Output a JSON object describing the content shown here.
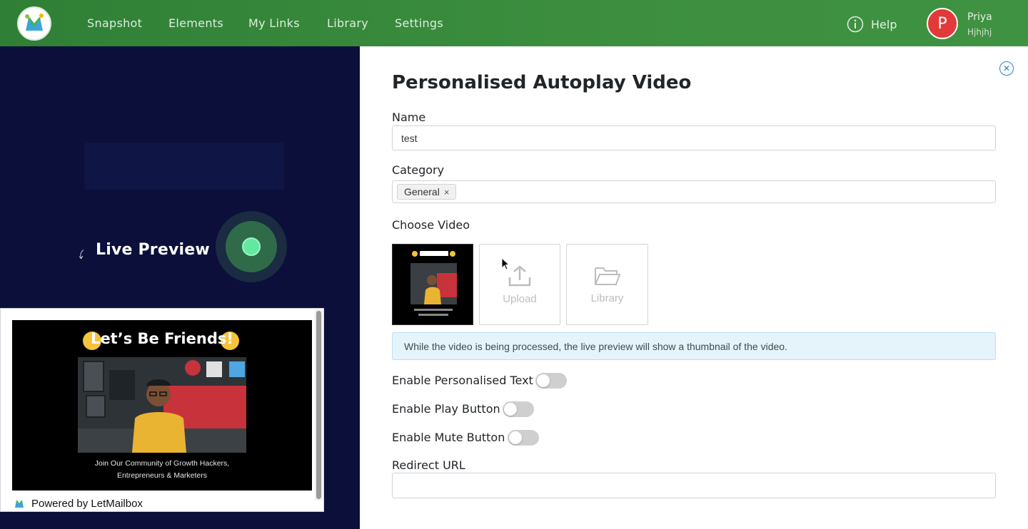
{
  "nav": {
    "items": [
      "Snapshot",
      "Elements",
      "My Links",
      "Library",
      "Settings"
    ],
    "help_label": "Help",
    "user": {
      "initial": "P",
      "name": "Priya",
      "subtitle": "Hjhjhj"
    }
  },
  "preview": {
    "live_label": "Live Preview",
    "video_title": "Let’s Be Friends!",
    "caption_line1": "Join Our Community of Growth Hackers,",
    "caption_line2": "Entrepreneurs & Marketers",
    "powered_by": "Powered by LetMailbox"
  },
  "form": {
    "title": "Personalised Autoplay Video",
    "name_label": "Name",
    "name_value": "test",
    "category_label": "Category",
    "category_tag": "General",
    "choose_video_label": "Choose Video",
    "upload_label": "Upload",
    "library_label": "Library",
    "info_text": "While the video is being processed, the live preview will show a thumbnail of the video.",
    "toggles": [
      {
        "label": "Enable Personalised Text",
        "enabled": false
      },
      {
        "label": "Enable Play Button",
        "enabled": false
      },
      {
        "label": "Enable Mute Button",
        "enabled": false
      }
    ],
    "redirect_label": "Redirect URL",
    "redirect_value": ""
  },
  "colors": {
    "nav_green": "#3d8f3f",
    "panel_dark": "#0b0f3a",
    "avatar_red": "#e23a3a",
    "info_bg": "#e5f4fb",
    "close_blue": "#2d7fc1"
  }
}
